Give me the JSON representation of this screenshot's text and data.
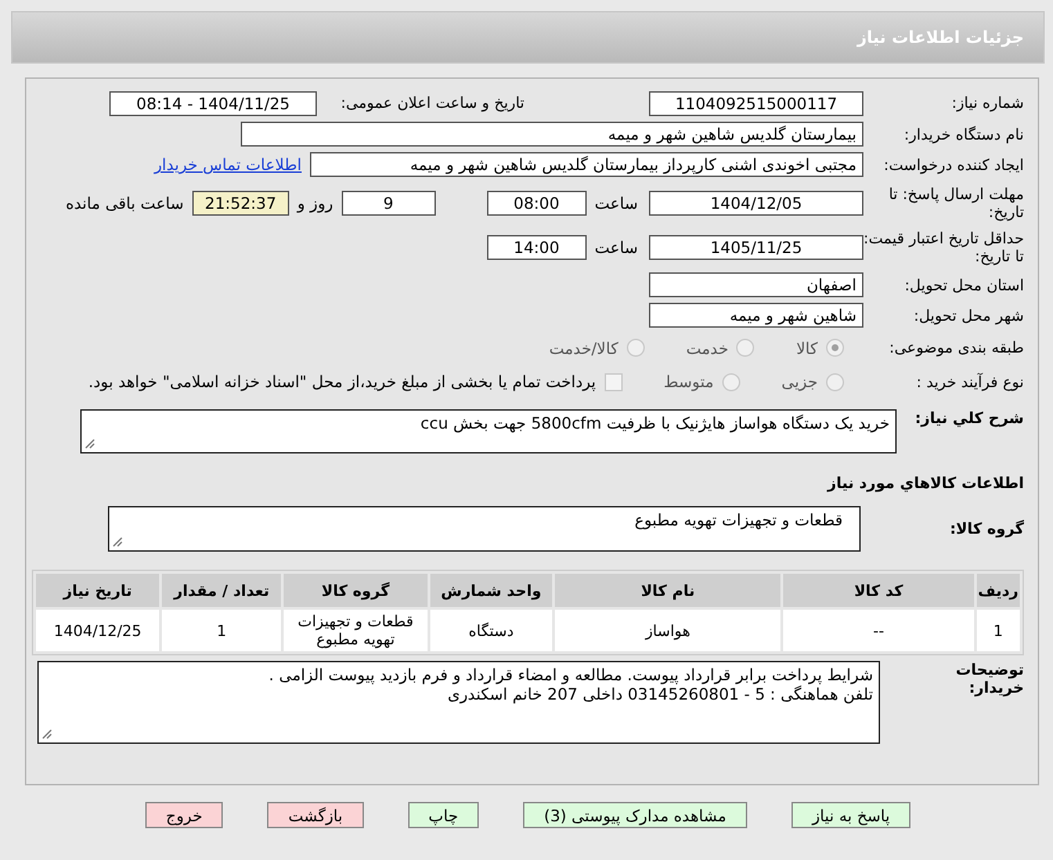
{
  "header": {
    "title": "جزئیات اطلاعات نیاز"
  },
  "need_number": {
    "label": "شماره نیاز:",
    "value": "1104092515000117"
  },
  "announce": {
    "label": "تاریخ و ساعت اعلان عمومی:",
    "value": "1404/11/25 - 08:14"
  },
  "buyer": {
    "label": "نام دستگاه خریدار:",
    "value": "بیمارستان گلدیس  شاهین شهر و میمه"
  },
  "creator": {
    "label": "ایجاد کننده درخواست:",
    "value": "مجتبی اخوندی اشنی کارپرداز بیمارستان گلدیس  شاهین شهر و میمه",
    "link": "اطلاعات تماس خریدار"
  },
  "deadline": {
    "label": "مهلت ارسال پاسخ: تا تاریخ:",
    "date": "1404/12/05",
    "time_label": "ساعت",
    "time": "08:00",
    "days": "9",
    "days_label": "روز و",
    "remaining": "21:52:37",
    "remaining_label": "ساعت باقی مانده"
  },
  "validity": {
    "label": "حداقل تاریخ اعتبار قیمت: تا تاریخ:",
    "date": "1405/11/25",
    "time_label": "ساعت",
    "time": "14:00"
  },
  "province": {
    "label": "استان محل تحویل:",
    "value": "اصفهان"
  },
  "city": {
    "label": "شهر محل تحویل:",
    "value": "شاهین شهر و میمه"
  },
  "category": {
    "label": "طبقه بندی موضوعی:",
    "options": [
      {
        "label": "کالا",
        "selected": true
      },
      {
        "label": "خدمت",
        "selected": false
      },
      {
        "label": "کالا/خدمت",
        "selected": false
      }
    ]
  },
  "process": {
    "label": "نوع فرآیند خرید :",
    "options": [
      {
        "label": "جزیی",
        "selected": false
      },
      {
        "label": "متوسط",
        "selected": false
      }
    ],
    "checkbox": {
      "label": "پرداخت تمام یا بخشی از مبلغ خرید،از محل \"اسناد خزانه اسلامی\" خواهد بود.",
      "checked": false
    }
  },
  "description": {
    "label": "شرح کلي نياز:",
    "value": "خرید یک دستگاه هواساز هایژنیک  با ظرفیت 5800cfm جهت بخش ccu"
  },
  "goods_title": "اطلاعات کالاهاي مورد نياز",
  "goods_group": {
    "label": "گروه کالا:",
    "value": "قطعات و تجهیزات تهویه مطبوع"
  },
  "table": {
    "columns": [
      "ردیف",
      "کد کالا",
      "نام کالا",
      "واحد شمارش",
      "گروه کالا",
      "تعداد / مقدار",
      "تاریخ نیاز"
    ],
    "rows": [
      [
        "1",
        "--",
        "هواساز",
        "دستگاه",
        "قطعات و تجهیزات تهویه مطبوع",
        "1",
        "1404/12/25"
      ]
    ]
  },
  "notes": {
    "label": "توضیحات خریدار:",
    "lines": [
      "شرایط پرداخت برابر قرارداد پیوست. مطالعه و امضاء قرارداد و فرم بازدید پیوست الزامی .",
      "تلفن هماهنگی : 5 - 03145260801 داخلی 207 خانم اسکندری"
    ]
  },
  "buttons": [
    {
      "label": "پاسخ به نیاز",
      "kind": "action"
    },
    {
      "label": "مشاهده مدارک پیوستی (3)",
      "kind": "action"
    },
    {
      "label": "چاپ",
      "kind": "action"
    },
    {
      "label": "بازگشت",
      "kind": "exit"
    },
    {
      "label": "خروج",
      "kind": "exit"
    }
  ]
}
